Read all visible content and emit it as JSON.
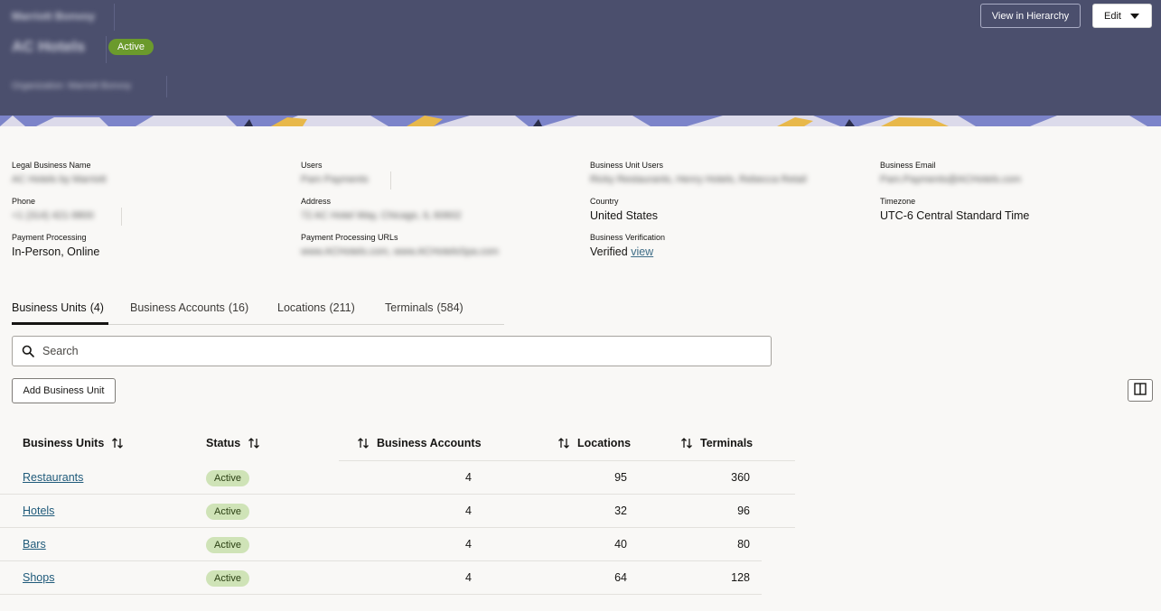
{
  "header": {
    "organization_title": "Marriott Bonvoy",
    "business_unit_name": "AC Hotels",
    "status": "Active",
    "organization_line": "Organization: Marriott Bonvoy",
    "view_hierarchy_label": "View in Hierarchy",
    "edit_label": "Edit"
  },
  "details": {
    "legal_business_name": {
      "label": "Legal Business Name",
      "value": "AC Hotels by Marriott"
    },
    "users": {
      "label": "Users",
      "value": "Pam Payments"
    },
    "business_unit_users": {
      "label": "Business Unit Users",
      "value": "Ricky Restaurants, Henry Hotels, Rebecca Retail"
    },
    "business_email": {
      "label": "Business Email",
      "value": "Pam.Payments@ACHotels.com"
    },
    "phone": {
      "label": "Phone",
      "value": "+1 (314) 421-9800"
    },
    "address": {
      "label": "Address",
      "value": "72 AC Hotel Way, Chicago, IL 60602"
    },
    "country": {
      "label": "Country",
      "value": "United States"
    },
    "timezone": {
      "label": "Timezone",
      "value": "UTC-6 Central Standard Time"
    },
    "payment_processing": {
      "label": "Payment Processing",
      "value": "In-Person, Online"
    },
    "payment_processing_urls": {
      "label": "Payment Processing URLs",
      "value": "www.ACHotels.com, www.ACHotelsSpa.com"
    },
    "business_verification": {
      "label": "Business Verification",
      "value": "Verified",
      "link": "view"
    }
  },
  "tabs": [
    {
      "label": "Business Units",
      "count": "(4)"
    },
    {
      "label": "Business Accounts",
      "count": "(16)"
    },
    {
      "label": "Locations",
      "count": "(211)"
    },
    {
      "label": "Terminals",
      "count": "(584)"
    }
  ],
  "search": {
    "placeholder": "Search"
  },
  "add_button_label": "Add Business Unit",
  "table": {
    "headers": [
      "Business Units",
      "Status",
      "Business Accounts",
      "Locations",
      "Terminals"
    ],
    "rows": [
      {
        "name": "Restaurants",
        "status": "Active",
        "accounts": "4",
        "locations": "95",
        "terminals": "360"
      },
      {
        "name": "Hotels",
        "status": "Active",
        "accounts": "4",
        "locations": "32",
        "terminals": "96"
      },
      {
        "name": "Bars",
        "status": "Active",
        "accounts": "4",
        "locations": "40",
        "terminals": "80"
      },
      {
        "name": "Shops",
        "status": "Active",
        "accounts": "4",
        "locations": "64",
        "terminals": "128"
      }
    ]
  },
  "colors": {
    "header_bg": "#4b4f6d",
    "active_header_pill": "#6b9a2c",
    "active_row_pill": "#cfe3b7",
    "link": "#1f5a7a"
  }
}
